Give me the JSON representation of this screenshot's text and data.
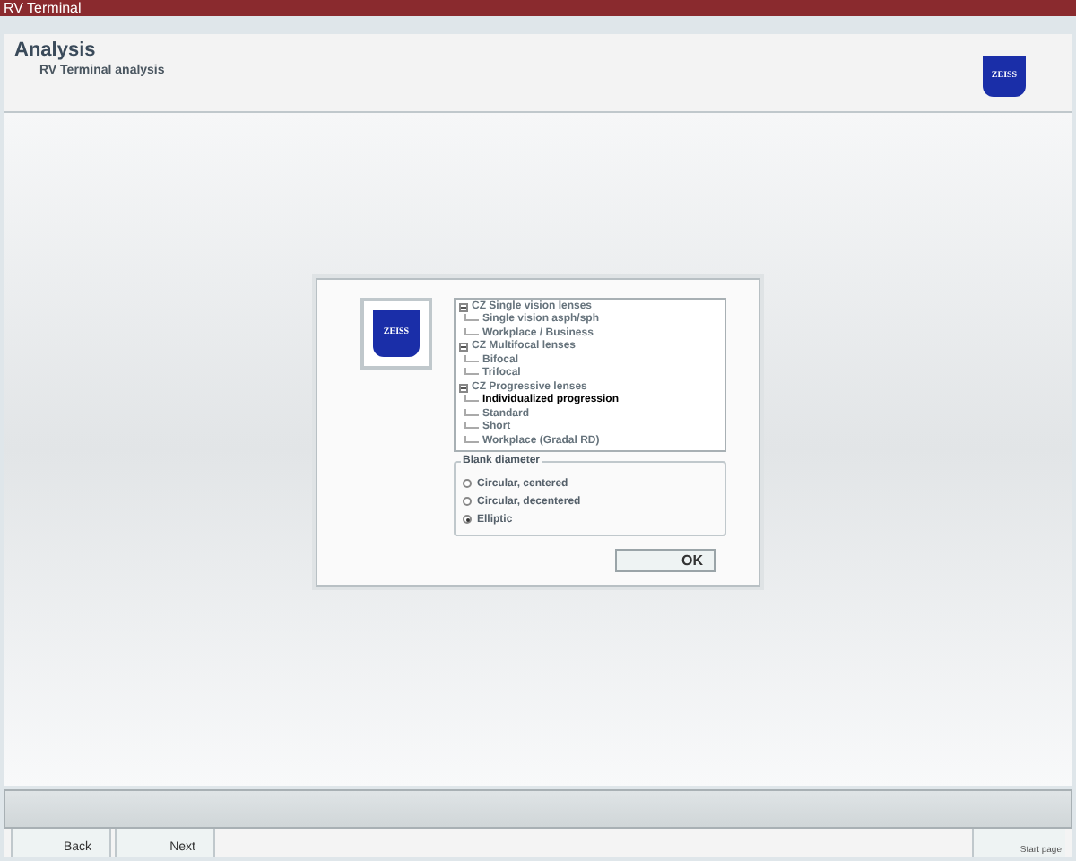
{
  "window": {
    "title": "RV Terminal"
  },
  "header": {
    "title": "Analysis",
    "subtitle": "RV Terminal analysis",
    "logo": "ZEISS"
  },
  "dialog": {
    "logo": "ZEISS",
    "tree": [
      {
        "label": "CZ Single vision lenses",
        "expanded": true,
        "selected": false,
        "children": [
          {
            "label": "Single vision asph/sph",
            "selected": false
          },
          {
            "label": "Workplace / Business",
            "selected": false
          }
        ]
      },
      {
        "label": "CZ Multifocal lenses",
        "expanded": true,
        "selected": false,
        "children": [
          {
            "label": "Bifocal",
            "selected": false
          },
          {
            "label": "Trifocal",
            "selected": false
          }
        ]
      },
      {
        "label": "CZ Progressive lenses",
        "expanded": true,
        "selected": false,
        "children": [
          {
            "label": "Individualized progression",
            "selected": true
          },
          {
            "label": "Standard",
            "selected": false
          },
          {
            "label": "Short",
            "selected": false
          },
          {
            "label": "Workplace (Gradal RD)",
            "selected": false
          }
        ]
      }
    ],
    "blank_diameter": {
      "title": "Blank diameter",
      "options": [
        {
          "label": "Circular, centered",
          "selected": false
        },
        {
          "label": "Circular, decentered",
          "selected": false
        },
        {
          "label": "Elliptic",
          "selected": true
        }
      ]
    },
    "ok": "OK"
  },
  "nav": [
    {
      "label": "Back"
    },
    {
      "label": "Next"
    }
  ],
  "start_page": "Start page"
}
